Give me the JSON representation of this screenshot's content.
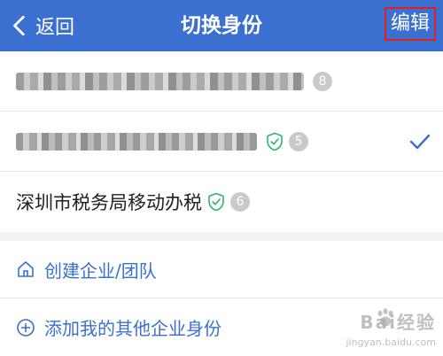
{
  "header": {
    "back_label": "返回",
    "title": "切换身份",
    "edit_label": "编辑",
    "background": "#3b6fd0"
  },
  "organizations": [
    {
      "name_visible": false,
      "verified": false,
      "badge": "8",
      "selected": false
    },
    {
      "name_visible": false,
      "verified": true,
      "badge": "5",
      "selected": true
    },
    {
      "name": "深圳市税务局移动办税",
      "name_visible": true,
      "verified": true,
      "badge": "6",
      "selected": false
    }
  ],
  "actions": [
    {
      "icon": "home-icon",
      "label": "创建企业/团队"
    },
    {
      "icon": "plus-circle-icon",
      "label": "添加我的其他企业身份"
    }
  ],
  "watermark": {
    "text": "Bai经验",
    "url": "jingyan.baidu.com"
  },
  "colors": {
    "accent": "#3b6fd0",
    "verified": "#2db86d",
    "badge": "#c9c9c9",
    "edit_highlight": "#e02020"
  }
}
